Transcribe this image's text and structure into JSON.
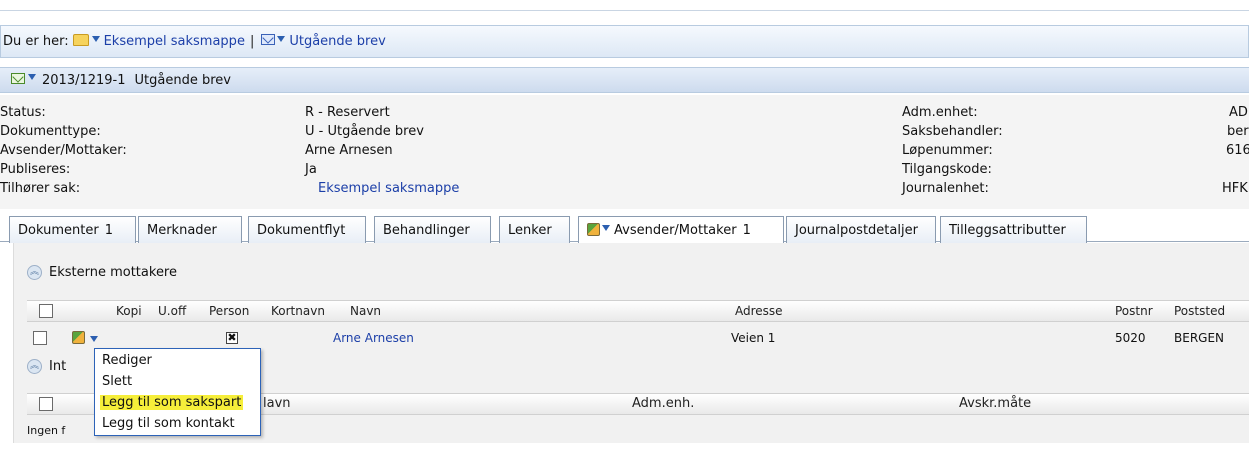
{
  "breadcrumb": {
    "prefix": "Du er her:",
    "items": [
      {
        "label": "Eksempel saksmappe",
        "icon": "folder-icon"
      },
      {
        "label": "Utgående brev",
        "icon": "envelope-icon"
      }
    ],
    "separator": "|"
  },
  "titlebar": {
    "document_number": "2013/1219-1",
    "title": "Utgående brev"
  },
  "fields": {
    "left": [
      {
        "label": "Status:",
        "value": "R - Reservert"
      },
      {
        "label": "Dokumenttype:",
        "value": "U - Utgående brev"
      },
      {
        "label": "Avsender/Mottaker:",
        "value": "Arne Arnesen"
      },
      {
        "label": "Publiseres:",
        "value": "Ja"
      },
      {
        "label": "Tilhører sak:",
        "value": "Eksempel saksmappe"
      }
    ],
    "right": [
      {
        "label": "Adm.enhet:",
        "value": "AD"
      },
      {
        "label": "Saksbehandler:",
        "value": "ber"
      },
      {
        "label": "Løpenummer:",
        "value": "616"
      },
      {
        "label": "Tilgangskode:",
        "value": ""
      },
      {
        "label": "Journalenhet:",
        "value": "HFK"
      }
    ]
  },
  "tabs": [
    {
      "label": "Dokumenter",
      "count": "1"
    },
    {
      "label": "Merknader",
      "count": ""
    },
    {
      "label": "Dokumentflyt",
      "count": ""
    },
    {
      "label": "Behandlinger",
      "count": ""
    },
    {
      "label": "Lenker",
      "count": ""
    },
    {
      "label": "Avsender/Mottaker",
      "count": "1",
      "active": true
    },
    {
      "label": "Journalpostdetaljer",
      "count": ""
    },
    {
      "label": "Tilleggsattributter",
      "count": ""
    }
  ],
  "external": {
    "title": "Eksterne mottakere",
    "columns": [
      "Kopi",
      "U.off",
      "Person",
      "Kortnavn",
      "Navn",
      "Adresse",
      "Postnr",
      "Poststed"
    ],
    "rows": [
      {
        "navn": "Arne Arnesen",
        "adresse": "Veien 1",
        "postnr": "5020",
        "poststed": "BERGEN",
        "person": "✖"
      }
    ]
  },
  "internal": {
    "title_visible": "Int",
    "columns_visible": [
      "lavn",
      "Adm.enh.",
      "Avskr.måte"
    ],
    "empty_visible": "Ingen f"
  },
  "context_menu": {
    "items": [
      "Rediger",
      "Slett",
      "Legg til som sakspart",
      "Legg til som kontakt"
    ],
    "highlighted_index": 2
  },
  "colors": {
    "link": "#1c3fa8",
    "highlight": "#f6ee3a",
    "menu_border": "#2d63b8"
  }
}
